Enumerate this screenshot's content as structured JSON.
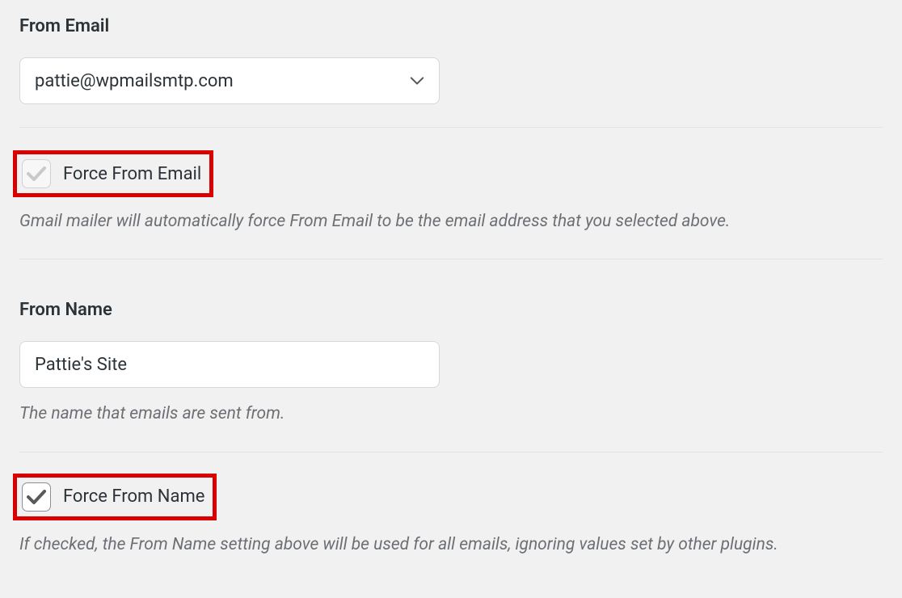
{
  "from_email": {
    "label": "From Email",
    "value": "pattie@wpmailsmtp.com",
    "force": {
      "label": "Force From Email",
      "checked": true,
      "disabled": true,
      "description": "Gmail mailer will automatically force From Email to be the email address that you selected above."
    }
  },
  "from_name": {
    "label": "From Name",
    "value": "Pattie's Site",
    "description": "The name that emails are sent from.",
    "force": {
      "label": "Force From Name",
      "checked": true,
      "disabled": false,
      "description": "If checked, the From Name setting above will be used for all emails, ignoring values set by other plugins."
    }
  }
}
